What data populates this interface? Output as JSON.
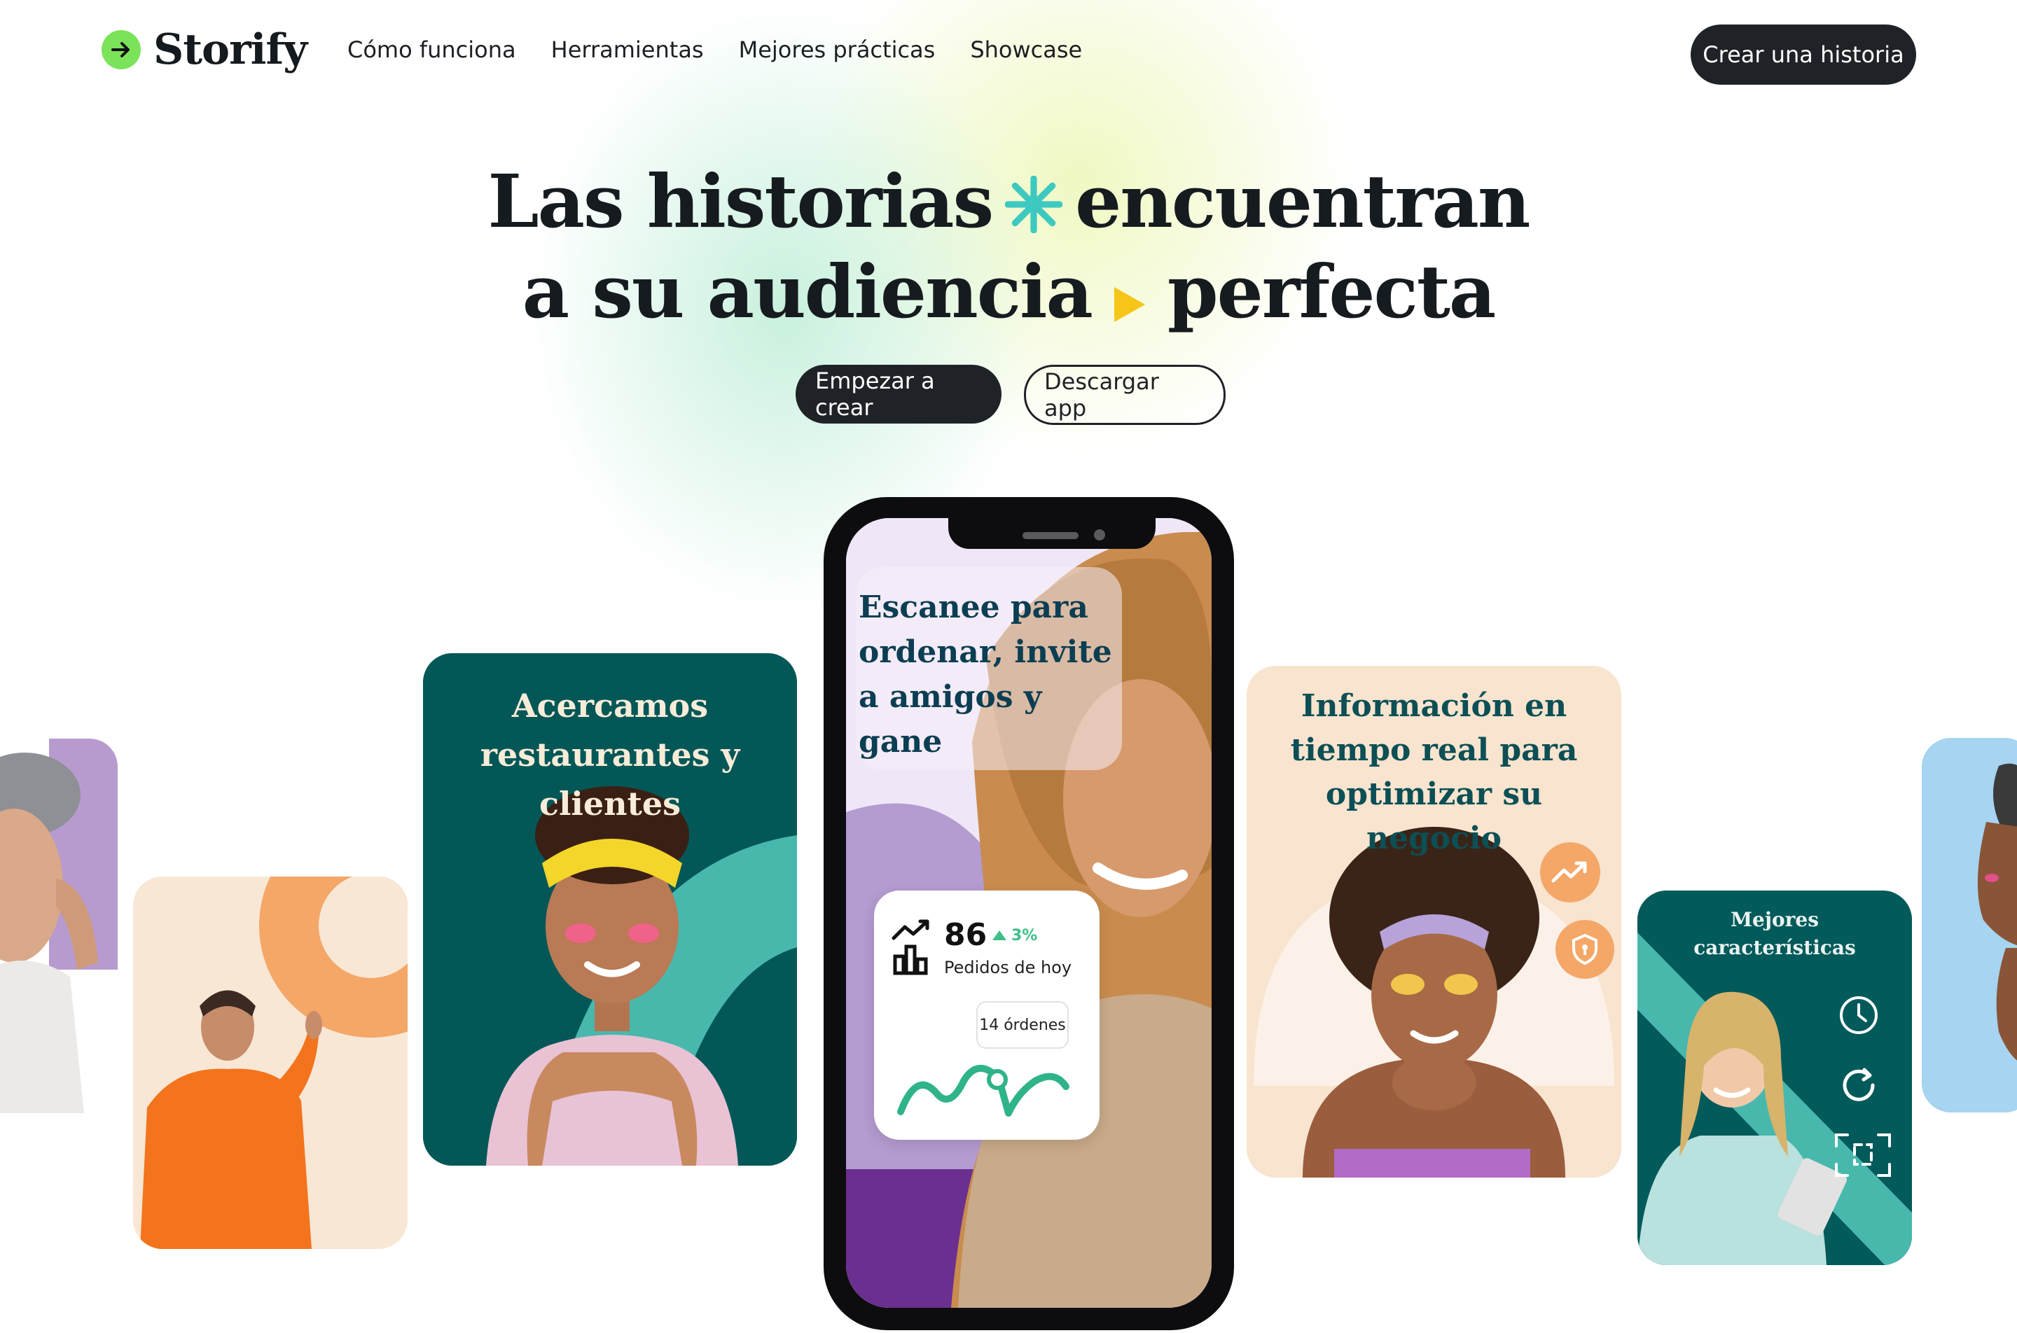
{
  "brand": {
    "name": "Storify",
    "accent": "#7be35a"
  },
  "nav": {
    "links": [
      "Cómo funciona",
      "Herramientas",
      "Mejores prácticas",
      "Showcase"
    ],
    "cta": "Crear una historia"
  },
  "hero": {
    "line1_a": "Las historias",
    "line1_b": "encuentran",
    "line2_a": "a su audiencia",
    "line2_b": "perfecta",
    "primary_button": "Empezar a crear",
    "secondary_button": "Descargar app"
  },
  "cards": {
    "restaurants": "Acercamos restaurantes y clientes",
    "phone_headline": "Escanee para ordenar, invite a amigos y gane",
    "info": "Información en tiempo real para optimizar su negocio",
    "features": "Mejores características"
  },
  "stats": {
    "value": "86",
    "change": "3%",
    "label": "Pedidos de hoy",
    "orders": "14 órdenes"
  },
  "colors": {
    "teal_dark": "#035757",
    "teal_light": "#48b8ad",
    "peach": "#f8e7d5",
    "orange": "#f4a767",
    "purple": "#b89bd0",
    "ink": "#1f2327"
  }
}
